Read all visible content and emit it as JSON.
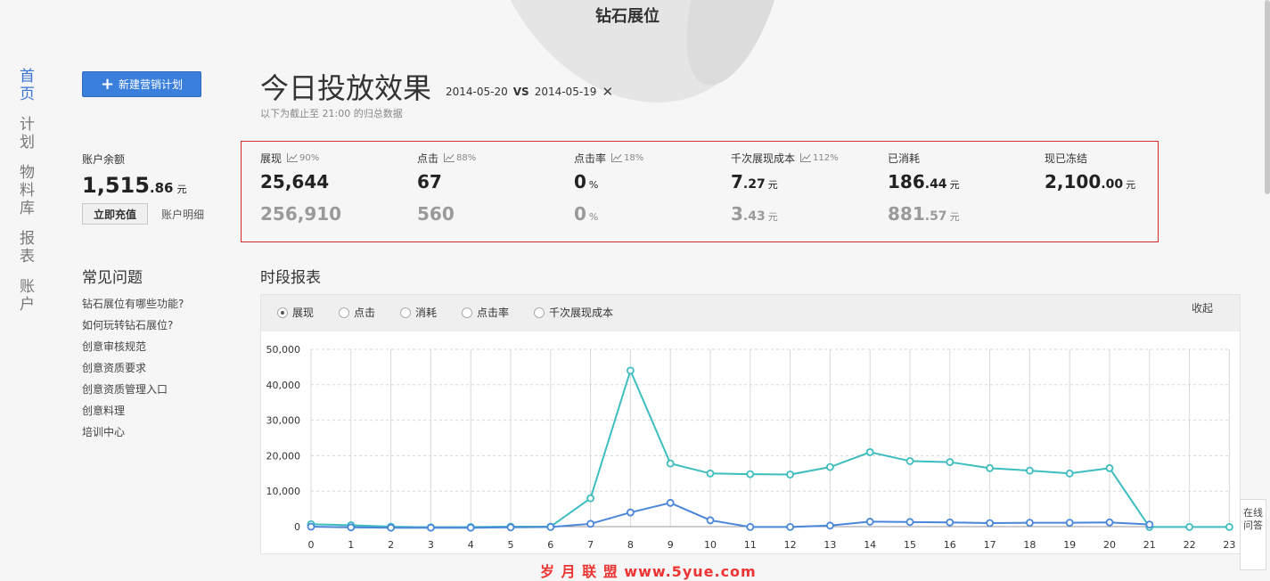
{
  "brand": "钻石展位",
  "nav": [
    {
      "label": "首页",
      "active": true
    },
    {
      "label": "计划"
    },
    {
      "label": "物料库"
    },
    {
      "label": "报表"
    },
    {
      "label": "账户"
    }
  ],
  "new_plan_button": "新建营销计划",
  "account": {
    "balance_label": "账户余额",
    "balance_int": "1,515",
    "balance_dec": ".86",
    "unit": "元",
    "recharge": "立即充值",
    "detail": "账户明细"
  },
  "faq": {
    "title": "常见问题",
    "items": [
      "钻石展位有哪些功能?",
      "如何玩转钻石展位?",
      "创意审核规范",
      "创意资质要求",
      "创意资质管理入口",
      "创意料理",
      "培训中心"
    ]
  },
  "header": {
    "title": "今日投放效果",
    "date_current": "2014-05-20",
    "vs": "VS",
    "date_compare": "2014-05-19",
    "close": "✕",
    "subtitle": "以下为截止至 21:00 的归总数据"
  },
  "metrics": [
    {
      "label": "展现",
      "pct": "90%",
      "now_int": "25,644",
      "now_dec": "",
      "now_unit": "",
      "prev_int": "256,910",
      "prev_dec": "",
      "prev_unit": ""
    },
    {
      "label": "点击",
      "pct": "88%",
      "now_int": "67",
      "now_dec": "",
      "now_unit": "",
      "prev_int": "560",
      "prev_dec": "",
      "prev_unit": ""
    },
    {
      "label": "点击率",
      "pct": "18%",
      "now_int": "0",
      "now_dec": "",
      "now_unit": "%",
      "prev_int": "0",
      "prev_dec": "",
      "prev_unit": "%"
    },
    {
      "label": "千次展现成本",
      "pct": "112%",
      "now_int": "7",
      "now_dec": ".27",
      "now_unit": "元",
      "prev_int": "3",
      "prev_dec": ".43",
      "prev_unit": "元"
    },
    {
      "label": "已消耗",
      "pct": "",
      "now_int": "186",
      "now_dec": ".44",
      "now_unit": "元",
      "prev_int": "881",
      "prev_dec": ".57",
      "prev_unit": "元"
    },
    {
      "label": "现已冻结",
      "pct": "",
      "now_int": "2,100",
      "now_dec": ".00",
      "now_unit": "元",
      "prev_int": "",
      "prev_dec": "",
      "prev_unit": ""
    }
  ],
  "report": {
    "title": "时段报表",
    "options": [
      {
        "label": "展现",
        "checked": true
      },
      {
        "label": "点击"
      },
      {
        "label": "消耗"
      },
      {
        "label": "点击率"
      },
      {
        "label": "千次展现成本"
      }
    ],
    "collapse": "收起"
  },
  "chart_data": {
    "type": "line",
    "x": [
      0,
      1,
      2,
      3,
      4,
      5,
      6,
      7,
      8,
      9,
      10,
      11,
      12,
      13,
      14,
      15,
      16,
      17,
      18,
      19,
      20,
      21,
      22,
      23
    ],
    "ylim": [
      0,
      50000
    ],
    "yticks": [
      0,
      10000,
      20000,
      30000,
      40000,
      50000
    ],
    "ytick_labels": [
      "0",
      "10,000",
      "20,000",
      "30,000",
      "40,000",
      "50,000"
    ],
    "grid": true,
    "series": [
      {
        "color": "#3ebdbf",
        "values": [
          700,
          400,
          0,
          -200,
          -100,
          0,
          0,
          8000,
          44000,
          17800,
          15000,
          14800,
          14700,
          16800,
          21000,
          18500,
          18200,
          16500,
          15800,
          15000,
          16500,
          -100,
          -100,
          -100
        ]
      },
      {
        "color": "#4a86d9",
        "values": [
          0,
          -200,
          -300,
          -300,
          -300,
          -200,
          -100,
          800,
          4000,
          6700,
          1800,
          -100,
          -100,
          300,
          1400,
          1300,
          1200,
          1000,
          1100,
          1100,
          1200,
          600,
          null,
          null
        ]
      }
    ]
  },
  "watermark": "岁 月 联 盟  www.5yue.com",
  "qa_float": "在线问答",
  "colors": {
    "accent": "#3b7fdd",
    "border_red": "#d62a2a"
  }
}
